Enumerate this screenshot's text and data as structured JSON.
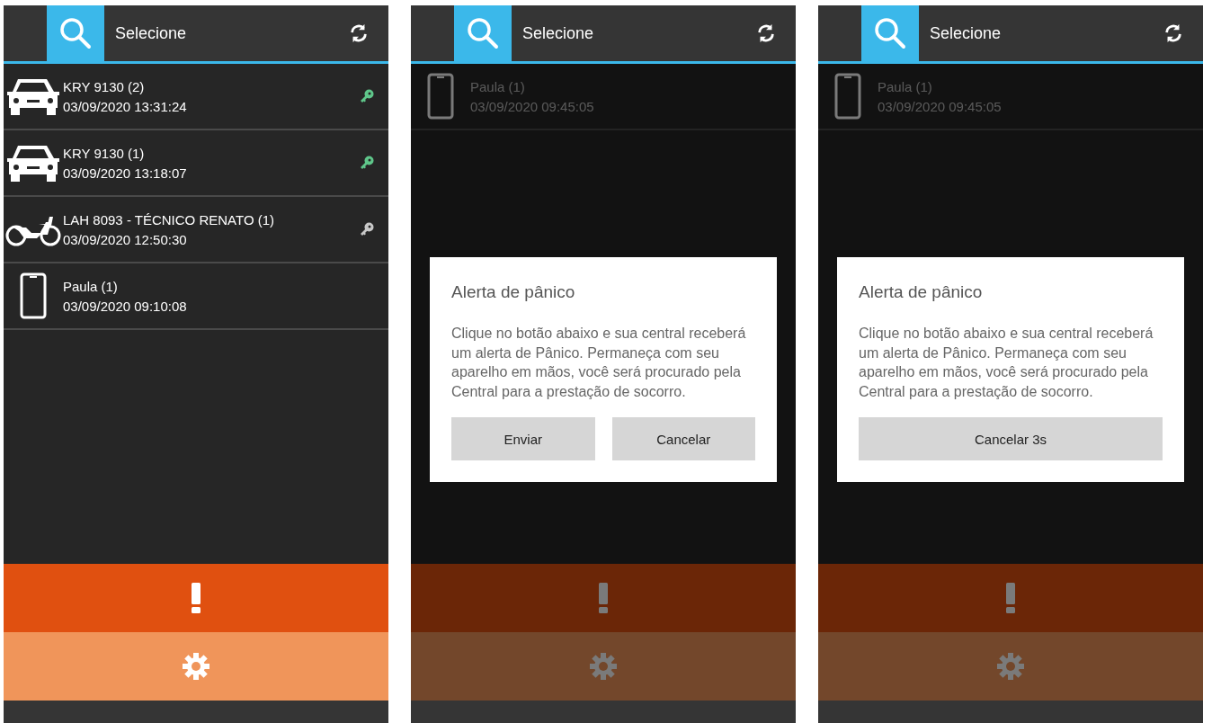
{
  "screens": [
    {
      "header": {
        "title": "Selecione"
      },
      "items": [
        {
          "kind": "car",
          "name": "KRY 9130 (2)",
          "time": "03/09/2020 13:31:24",
          "color": "#5fc68a"
        },
        {
          "kind": "car",
          "name": "KRY 9130 (1)",
          "time": "03/09/2020 13:18:07",
          "color": "#5fc68a"
        },
        {
          "kind": "motorcycle",
          "name": "LAH 8093 - TÉCNICO RENATO (1)",
          "time": "03/09/2020 12:50:30",
          "color": "#c8c8c8"
        },
        {
          "kind": "phone",
          "name": "Paula (1)",
          "time": "03/09/2020 09:10:08"
        }
      ]
    },
    {
      "header": {
        "title": "Selecione"
      },
      "items": [
        {
          "kind": "phone",
          "name": "Paula (1)",
          "time": "03/09/2020 09:45:05"
        }
      ],
      "dialog": {
        "title": "Alerta de pânico",
        "body": "Clique no botão abaixo e sua central receberá um alerta de Pânico. Permaneça com seu aparelho em mãos, você será procurado pela Central para a prestação de socorro.",
        "buttons": [
          "Enviar",
          "Cancelar"
        ]
      }
    },
    {
      "header": {
        "title": "Selecione"
      },
      "items": [
        {
          "kind": "phone",
          "name": "Paula (1)",
          "time": "03/09/2020 09:45:05"
        }
      ],
      "dialog": {
        "title": "Alerta de pânico",
        "body": "Clique no botão abaixo e sua central receberá um alerta de Pânico. Permaneça com seu aparelho em mãos, você será procurado pela Central para a prestação de socorro.",
        "buttons": [
          "Cancelar 3s"
        ]
      }
    }
  ]
}
